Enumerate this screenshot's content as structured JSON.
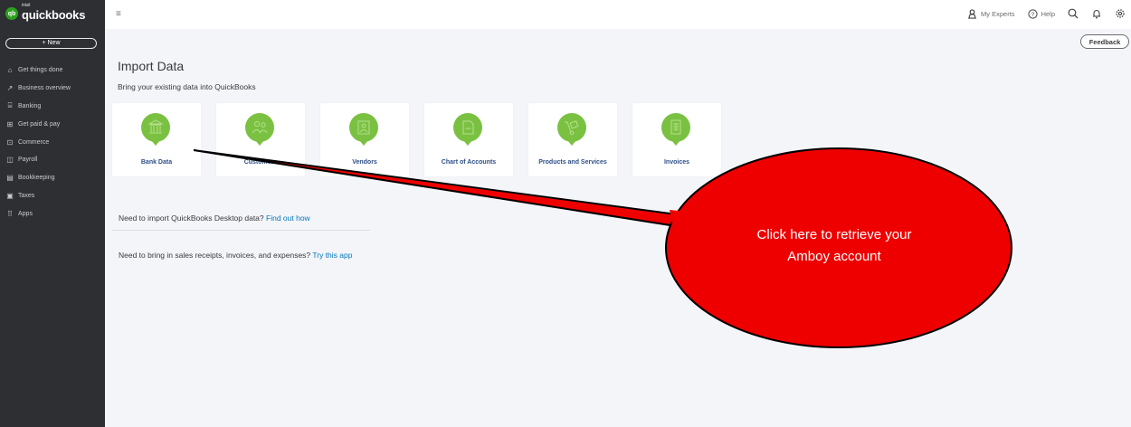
{
  "brand": {
    "badge": "qb",
    "small": "intuit",
    "name": "quickbooks"
  },
  "sidebar": {
    "new_label": "+ New",
    "items": [
      {
        "icon": "⌂",
        "label": "Get things done"
      },
      {
        "icon": "↗",
        "label": "Business overview"
      },
      {
        "icon": "⌸",
        "label": "Banking"
      },
      {
        "icon": "⊞",
        "label": "Get paid & pay"
      },
      {
        "icon": "⊡",
        "label": "Commerce"
      },
      {
        "icon": "◫",
        "label": "Payroll"
      },
      {
        "icon": "▤",
        "label": "Bookkeeping"
      },
      {
        "icon": "▣",
        "label": "Taxes"
      },
      {
        "icon": "⠿",
        "label": "Apps"
      }
    ]
  },
  "topbar": {
    "menu_icon": "≡",
    "my_experts": "My Experts",
    "help": "Help",
    "feedback": "Feedback"
  },
  "main": {
    "title": "Import Data",
    "subtitle": "Bring your existing data into QuickBooks",
    "cards": [
      {
        "label": "Bank Data",
        "icon": "bank-icon"
      },
      {
        "label": "Customers",
        "icon": "customers-icon"
      },
      {
        "label": "Vendors",
        "icon": "vendors-icon"
      },
      {
        "label": "Chart of Accounts",
        "icon": "chart-of-accounts-icon"
      },
      {
        "label": "Products and Services",
        "icon": "products-icon"
      },
      {
        "label": "Invoices",
        "icon": "invoices-icon"
      }
    ],
    "info1_text": "Need to import QuickBooks Desktop data?",
    "info1_link": "Find out how",
    "info2_text": "Need to bring in sales receipts, invoices, and expenses?",
    "info2_link": "Try this app"
  },
  "callout": {
    "line1": "Click here to retrieve your",
    "line2": "Amboy account"
  },
  "colors": {
    "sidebar_bg": "#2d2f33",
    "brand_green": "#2ca01c",
    "pin_green": "#7ac142",
    "card_label_blue": "#2e4f87",
    "link_blue": "#0077c5",
    "callout_red": "#ee0000"
  }
}
